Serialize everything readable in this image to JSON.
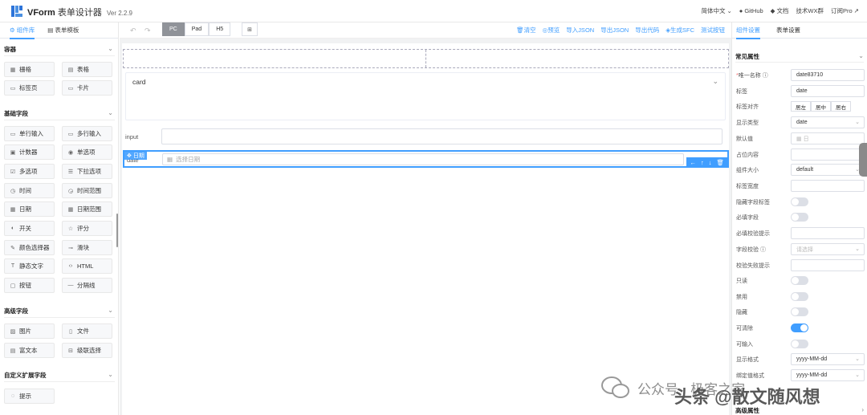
{
  "header": {
    "app_name": "VForm",
    "app_subtitle": "表单设计器",
    "version": "Ver 2.2.9",
    "links": [
      "简体中文",
      "GitHub",
      "文档",
      "技术WX群",
      "订阅Pro"
    ]
  },
  "left_panel": {
    "tabs": [
      "组件库",
      "表单模板"
    ],
    "groups": [
      {
        "title": "容器",
        "items": [
          "栅格",
          "表格",
          "标签页",
          "卡片"
        ]
      },
      {
        "title": "基础字段",
        "items": [
          "单行输入",
          "多行输入",
          "计数器",
          "单选项",
          "多选项",
          "下拉选项",
          "时间",
          "时间范围",
          "日期",
          "日期范围",
          "开关",
          "评分",
          "颜色选择器",
          "滑块",
          "静态文字",
          "HTML",
          "按钮",
          "分隔线"
        ]
      },
      {
        "title": "高级字段",
        "items": [
          "图片",
          "文件",
          "富文本",
          "级联选择"
        ]
      },
      {
        "title": "自定义扩展字段",
        "items": [
          "提示"
        ]
      }
    ]
  },
  "toolbar": {
    "devices": [
      "PC",
      "Pad",
      "H5"
    ],
    "active_device": "PC",
    "actions": [
      "清空",
      "预览",
      "导入JSON",
      "导出JSON",
      "导出代码",
      "生成SFC",
      "测试按钮"
    ]
  },
  "canvas": {
    "card_title": "card",
    "input_label": "input",
    "date_label": "date",
    "date_tag": "日期",
    "date_placeholder": "选择日期"
  },
  "right_panel": {
    "tabs": [
      "组件设置",
      "表单设置"
    ],
    "section_common": "常见属性",
    "section_advanced": "高级属性",
    "props": {
      "unique_name": {
        "label": "唯一名称",
        "value": "date83710"
      },
      "label": {
        "label": "标签",
        "value": "date"
      },
      "label_align": {
        "label": "标签对齐",
        "options": [
          "居左",
          "居中",
          "居右"
        ]
      },
      "display_type": {
        "label": "显示类型",
        "value": "date"
      },
      "default_value": {
        "label": "默认值",
        "placeholder": "日"
      },
      "placeholder": {
        "label": "占位内容"
      },
      "size": {
        "label": "组件大小",
        "value": "default"
      },
      "label_width": {
        "label": "标签宽度"
      },
      "hide_label": {
        "label": "隐藏字段标签",
        "on": false
      },
      "required": {
        "label": "必填字段",
        "on": false
      },
      "required_hint": {
        "label": "必填校验提示"
      },
      "validation": {
        "label": "字段校验",
        "placeholder": "请选择"
      },
      "validation_hint": {
        "label": "校验失败提示"
      },
      "readonly": {
        "label": "只读",
        "on": false
      },
      "disabled": {
        "label": "禁用",
        "on": false
      },
      "hidden": {
        "label": "隐藏",
        "on": false
      },
      "clearable": {
        "label": "可清除",
        "on": true
      },
      "editable": {
        "label": "可输入",
        "on": false
      },
      "display_format": {
        "label": "显示格式",
        "value": "yyyy-MM-dd"
      },
      "value_format": {
        "label": "绑定值格式",
        "value": "yyyy-MM-dd"
      }
    }
  },
  "watermark": {
    "line1": "公众号 · 极客之家",
    "line2": "头条 @散文随风想"
  },
  "colors": {
    "accent": "#409eff",
    "switch_off": "#dcdfe6",
    "device_active": "#909399"
  }
}
